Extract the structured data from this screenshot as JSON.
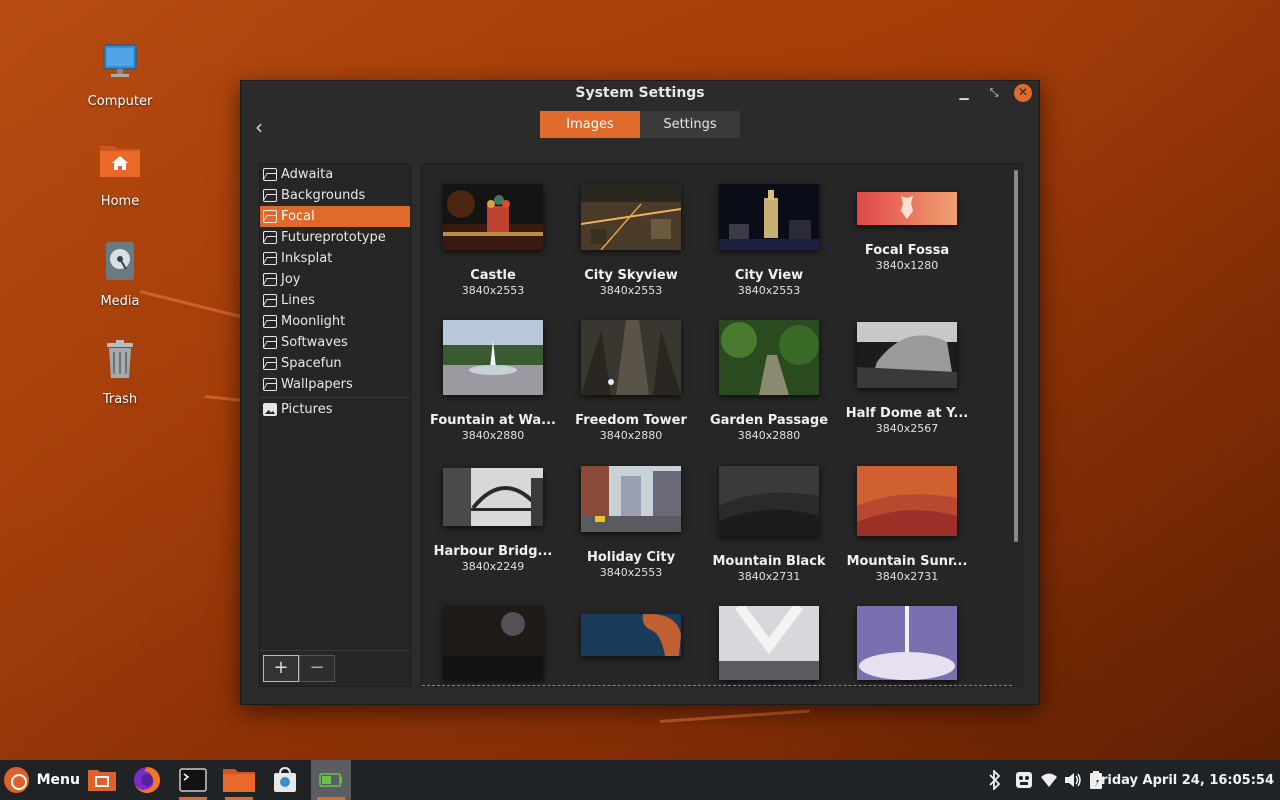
{
  "desktop": {
    "icons": [
      {
        "label": "Computer"
      },
      {
        "label": "Home"
      },
      {
        "label": "Media"
      },
      {
        "label": "Trash"
      }
    ]
  },
  "window": {
    "title": "System Settings",
    "tabs": [
      {
        "label": "Images"
      },
      {
        "label": "Settings"
      }
    ],
    "sidebar": {
      "items": [
        {
          "label": "Adwaita"
        },
        {
          "label": "Backgrounds"
        },
        {
          "label": "Focal"
        },
        {
          "label": "Futureprototype"
        },
        {
          "label": "Inksplat"
        },
        {
          "label": "Joy"
        },
        {
          "label": "Lines"
        },
        {
          "label": "Moonlight"
        },
        {
          "label": "Softwaves"
        },
        {
          "label": "Spacefun"
        },
        {
          "label": "Wallpapers"
        }
      ],
      "pictures_label": "Pictures",
      "add_label": "+",
      "remove_label": "−"
    },
    "images": [
      {
        "name": "Castle",
        "res": "3840x2553"
      },
      {
        "name": "City Skyview",
        "res": "3840x2553"
      },
      {
        "name": "City View",
        "res": "3840x2553"
      },
      {
        "name": "Focal Fossa",
        "res": "3840x1280"
      },
      {
        "name": "Fountain at Wa...",
        "res": "3840x2880"
      },
      {
        "name": "Freedom Tower",
        "res": "3840x2880"
      },
      {
        "name": "Garden Passage",
        "res": "3840x2880"
      },
      {
        "name": "Half Dome at Y...",
        "res": "3840x2567"
      },
      {
        "name": "Harbour Bridg...",
        "res": "3840x2249"
      },
      {
        "name": "Holiday City",
        "res": "3840x2553"
      },
      {
        "name": "Mountain Black",
        "res": "3840x2731"
      },
      {
        "name": "Mountain Sunr...",
        "res": "3840x2731"
      }
    ]
  },
  "taskbar": {
    "menu_label": "Menu",
    "clock": "Friday April 24, 16:05:54"
  },
  "colors": {
    "accent": "#e06a2c"
  }
}
